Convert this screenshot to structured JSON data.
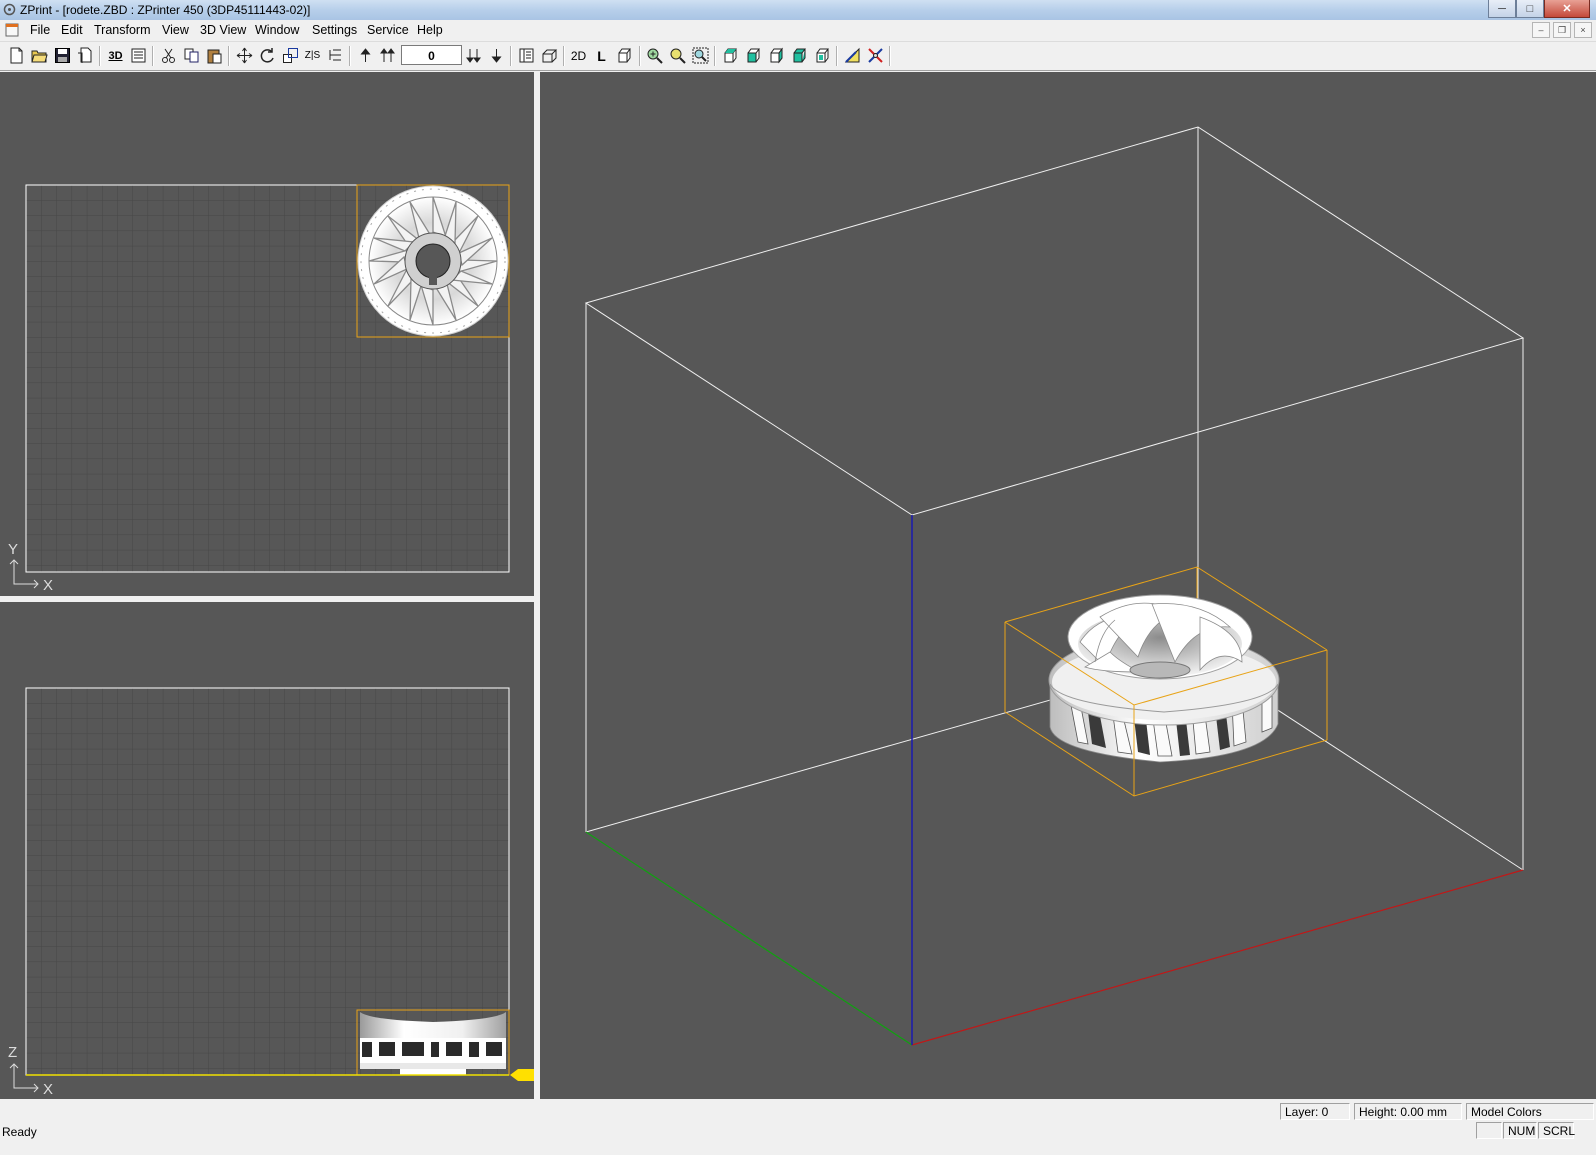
{
  "window": {
    "title": "ZPrint - [rodete.ZBD : ZPrinter 450 (3DP45111443-02)]",
    "minimize_label": "─",
    "maximize_label": "□",
    "close_label": "✕"
  },
  "menu": {
    "items": [
      "File",
      "Edit",
      "Transform",
      "View",
      "3D View",
      "Window",
      "Settings",
      "Service",
      "Help"
    ]
  },
  "mdi": {
    "minimize": "–",
    "restore": "❐",
    "close": "×"
  },
  "toolbar": {
    "layer_value": "0",
    "label_3d": "3D",
    "label_2d": "2D",
    "label_l": "L",
    "label_zs": "Z|S"
  },
  "top_view": {
    "axis_vertical": "Y",
    "axis_horizontal": "X"
  },
  "front_view": {
    "axis_vertical": "Z",
    "axis_horizontal": "X"
  },
  "status": {
    "ready": "Ready",
    "layer": "Layer: 0",
    "height": "Height: 0.00 mm",
    "mode": "Model Colors",
    "num": "NUM",
    "scrl": "SCRL"
  },
  "colors": {
    "viewport_bg": "#575757",
    "bbox_outline": "#e8a317",
    "axis_x": "#c01818",
    "axis_y": "#10a010",
    "axis_z": "#1a1ab0"
  }
}
